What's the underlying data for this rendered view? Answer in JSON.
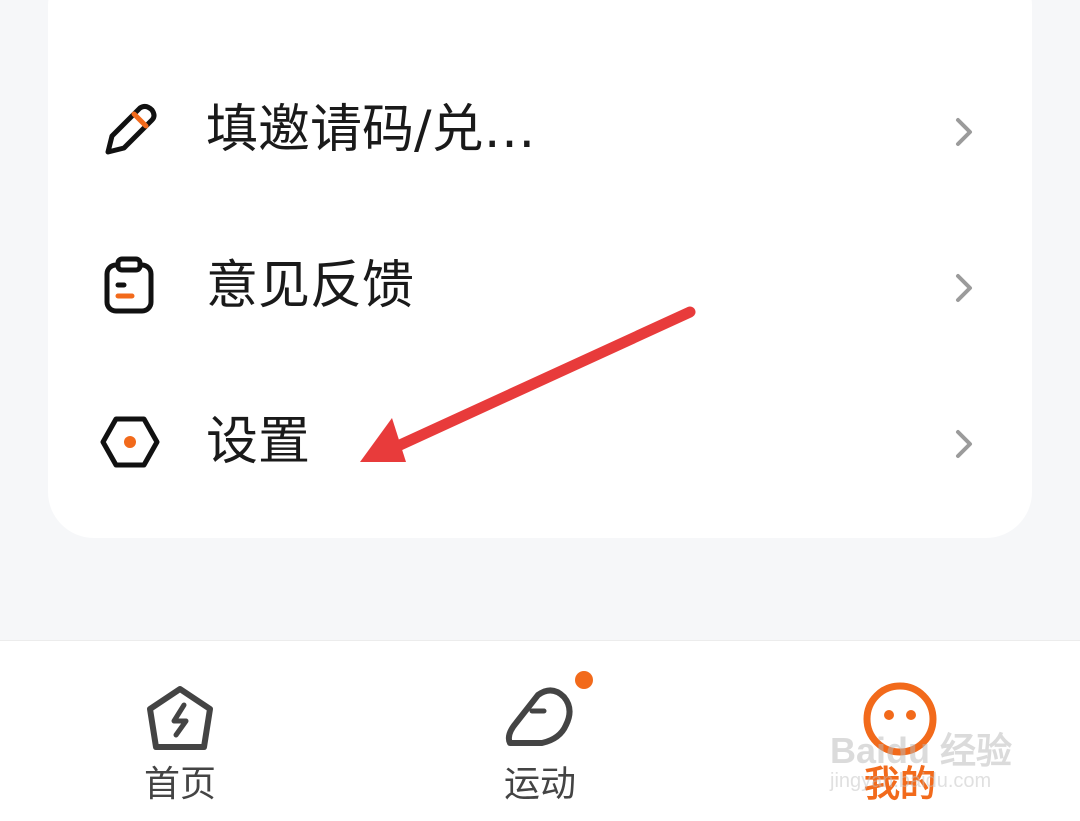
{
  "menu": {
    "items": [
      {
        "label": "填邀请码/兑…",
        "icon": "pencil-icon"
      },
      {
        "label": "意见反馈",
        "icon": "clipboard-icon"
      },
      {
        "label": "设置",
        "icon": "hexagon-settings-icon"
      }
    ]
  },
  "tabbar": {
    "tabs": [
      {
        "label": "首页",
        "icon": "home-bolt-icon",
        "active": false
      },
      {
        "label": "运动",
        "icon": "sneaker-icon",
        "active": false,
        "badge_dot": true
      },
      {
        "label": "我的",
        "icon": "smiley-face-icon",
        "active": true
      }
    ]
  },
  "watermark": {
    "main": "Baidu 经验",
    "sub": "jingyan.baidu.com"
  },
  "colors": {
    "accent": "#f26a1b",
    "annotation_arrow": "#e83b3b",
    "text": "#1a1a1a",
    "chevron": "#9b9b9b",
    "background": "#f6f7f9"
  }
}
